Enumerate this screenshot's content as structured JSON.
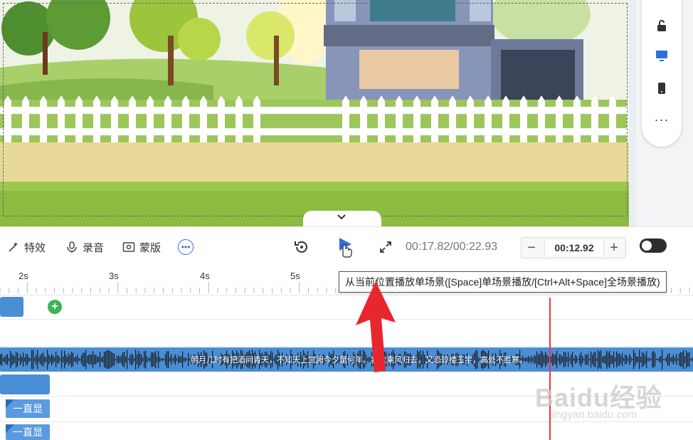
{
  "toolbar": {
    "effects_label": "特效",
    "record_label": "录音",
    "mask_label": "蒙版",
    "time_readout": "00:17.82/00:22.93",
    "duration_value": "00:12.92",
    "minus_label": "−",
    "plus_label": "+"
  },
  "tooltip": {
    "text": "从当前位置播放单场景([Space]单场景播放/[Ctrl+Alt+Space]全场景播放)"
  },
  "timeline": {
    "ruler_ticks": [
      "2s",
      "3s",
      "4s",
      "5s"
    ],
    "lyrics": "明月几时有把酒问青天，不知天上宫阙今夕是何年。我欲乘风归去，又恐琼楼玉宇，高处不胜寒。",
    "tag_clips": [
      "一直显",
      "一直显"
    ]
  },
  "watermark": {
    "main": "Baidu经验",
    "sub": "jingyan.baidu.com"
  },
  "colors": {
    "accent": "#2f6fdc",
    "track_blue": "#4a8ed6",
    "playhead_red": "#e8383d",
    "add_green": "#3fb35a"
  },
  "icons": [
    "unlock-icon",
    "desktop-icon",
    "phone-icon",
    "more-icon",
    "effects-icon",
    "microphone-icon",
    "mask-icon",
    "replay-icon",
    "play-icon",
    "fullscreen-icon",
    "chevron-down-icon"
  ]
}
